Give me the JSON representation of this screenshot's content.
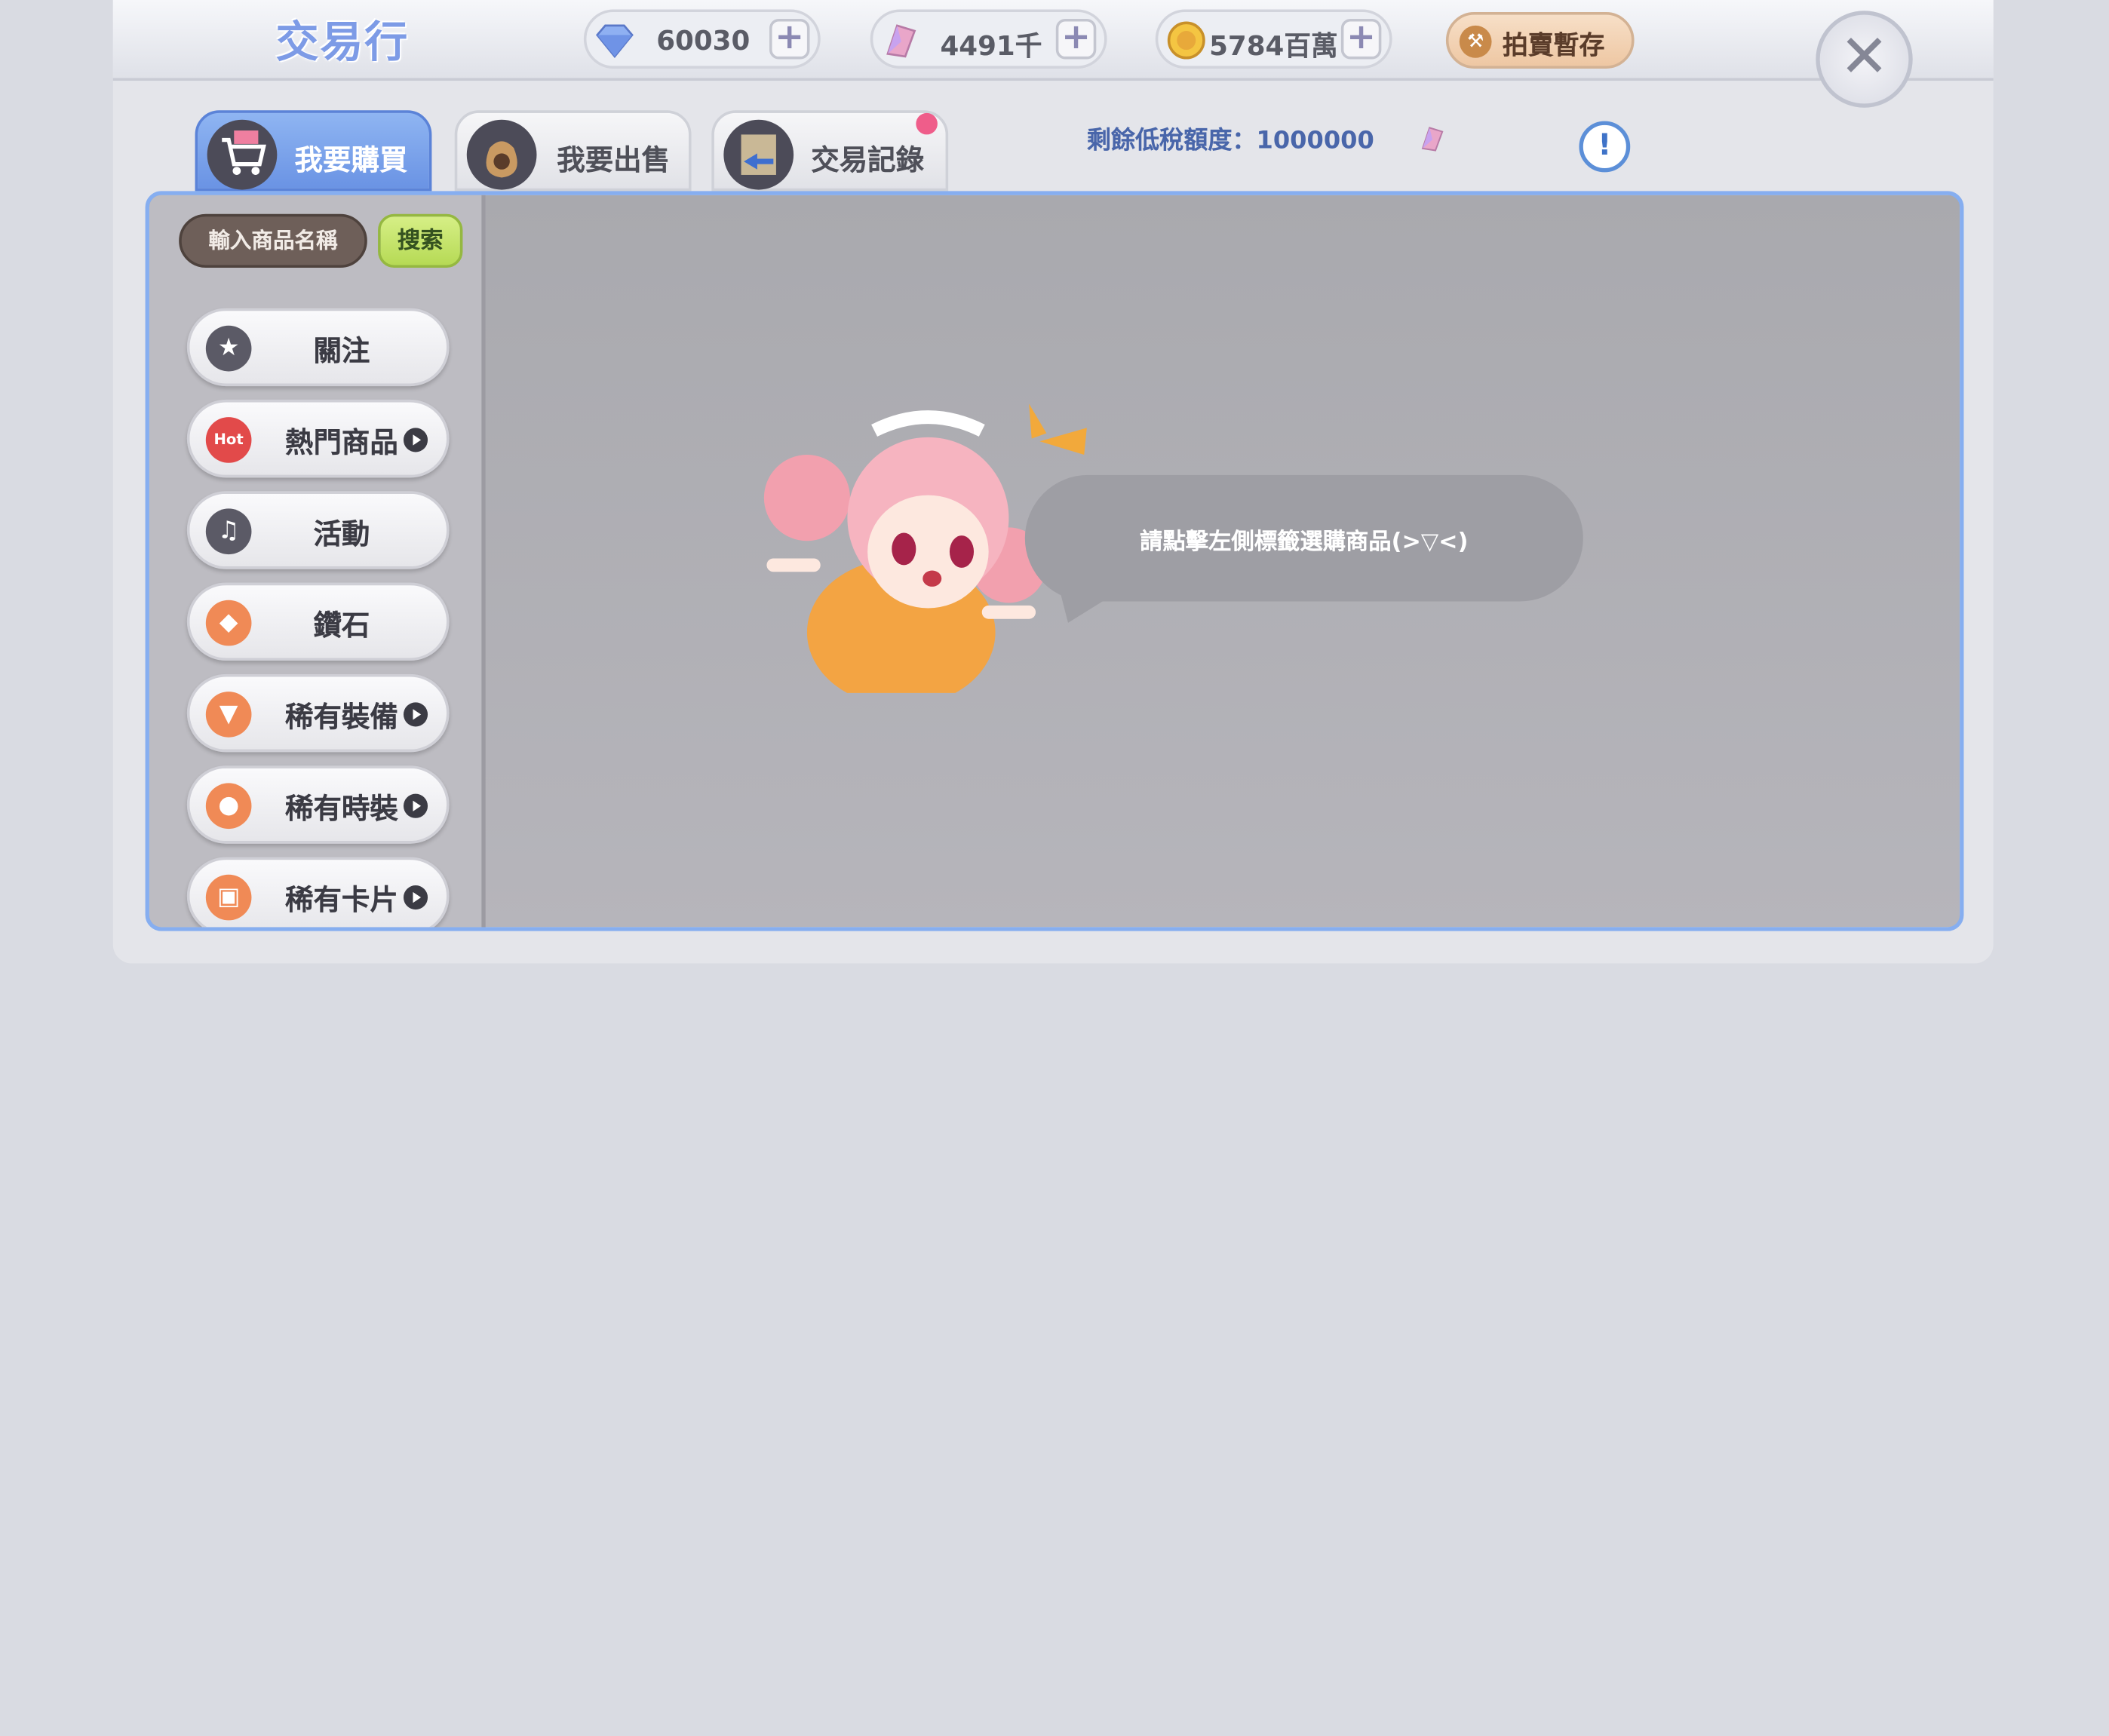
{
  "header": {
    "title": "交易行"
  },
  "currencies": [
    {
      "icon": "diamond-icon",
      "value": "60030"
    },
    {
      "icon": "crystal-wing-icon",
      "value": "4491千"
    },
    {
      "icon": "zeny-coin-icon",
      "value": "5784百萬"
    }
  ],
  "auction_storage": {
    "label": "拍賣暫存",
    "icon": "hammer-icon"
  },
  "tabs": [
    {
      "label": "我要購買",
      "icon": "cart-icon",
      "active": true
    },
    {
      "label": "我要出售",
      "icon": "money-bag-icon",
      "active": false
    },
    {
      "label": "交易記錄",
      "icon": "ledger-icon",
      "active": false,
      "badge": true
    }
  ],
  "tax": {
    "label": "剩餘低稅額度：1000000",
    "icon": "crystal-wing-icon"
  },
  "search": {
    "placeholder": "輸入商品名稱",
    "button": "搜索"
  },
  "categories": [
    {
      "label": "關注",
      "icon": "star-icon",
      "color": "#5b5a66",
      "arrow": false
    },
    {
      "label": "熱門商品",
      "icon": "hot-icon",
      "color": "#e24a4a",
      "arrow": true
    },
    {
      "label": "活動",
      "icon": "bell-icon",
      "color": "#5b5a66",
      "arrow": false
    },
    {
      "label": "鑽石",
      "icon": "gem-icon",
      "color": "#f08a56",
      "arrow": false
    },
    {
      "label": "稀有裝備",
      "icon": "shirt-icon",
      "color": "#f08a56",
      "arrow": true
    },
    {
      "label": "稀有時裝",
      "icon": "hat-icon",
      "color": "#f08a56",
      "arrow": true
    },
    {
      "label": "稀有卡片",
      "icon": "card-icon",
      "color": "#f08a56",
      "arrow": true
    }
  ],
  "empty_hint": "請點擊左側標籤選購商品(>▽<)"
}
